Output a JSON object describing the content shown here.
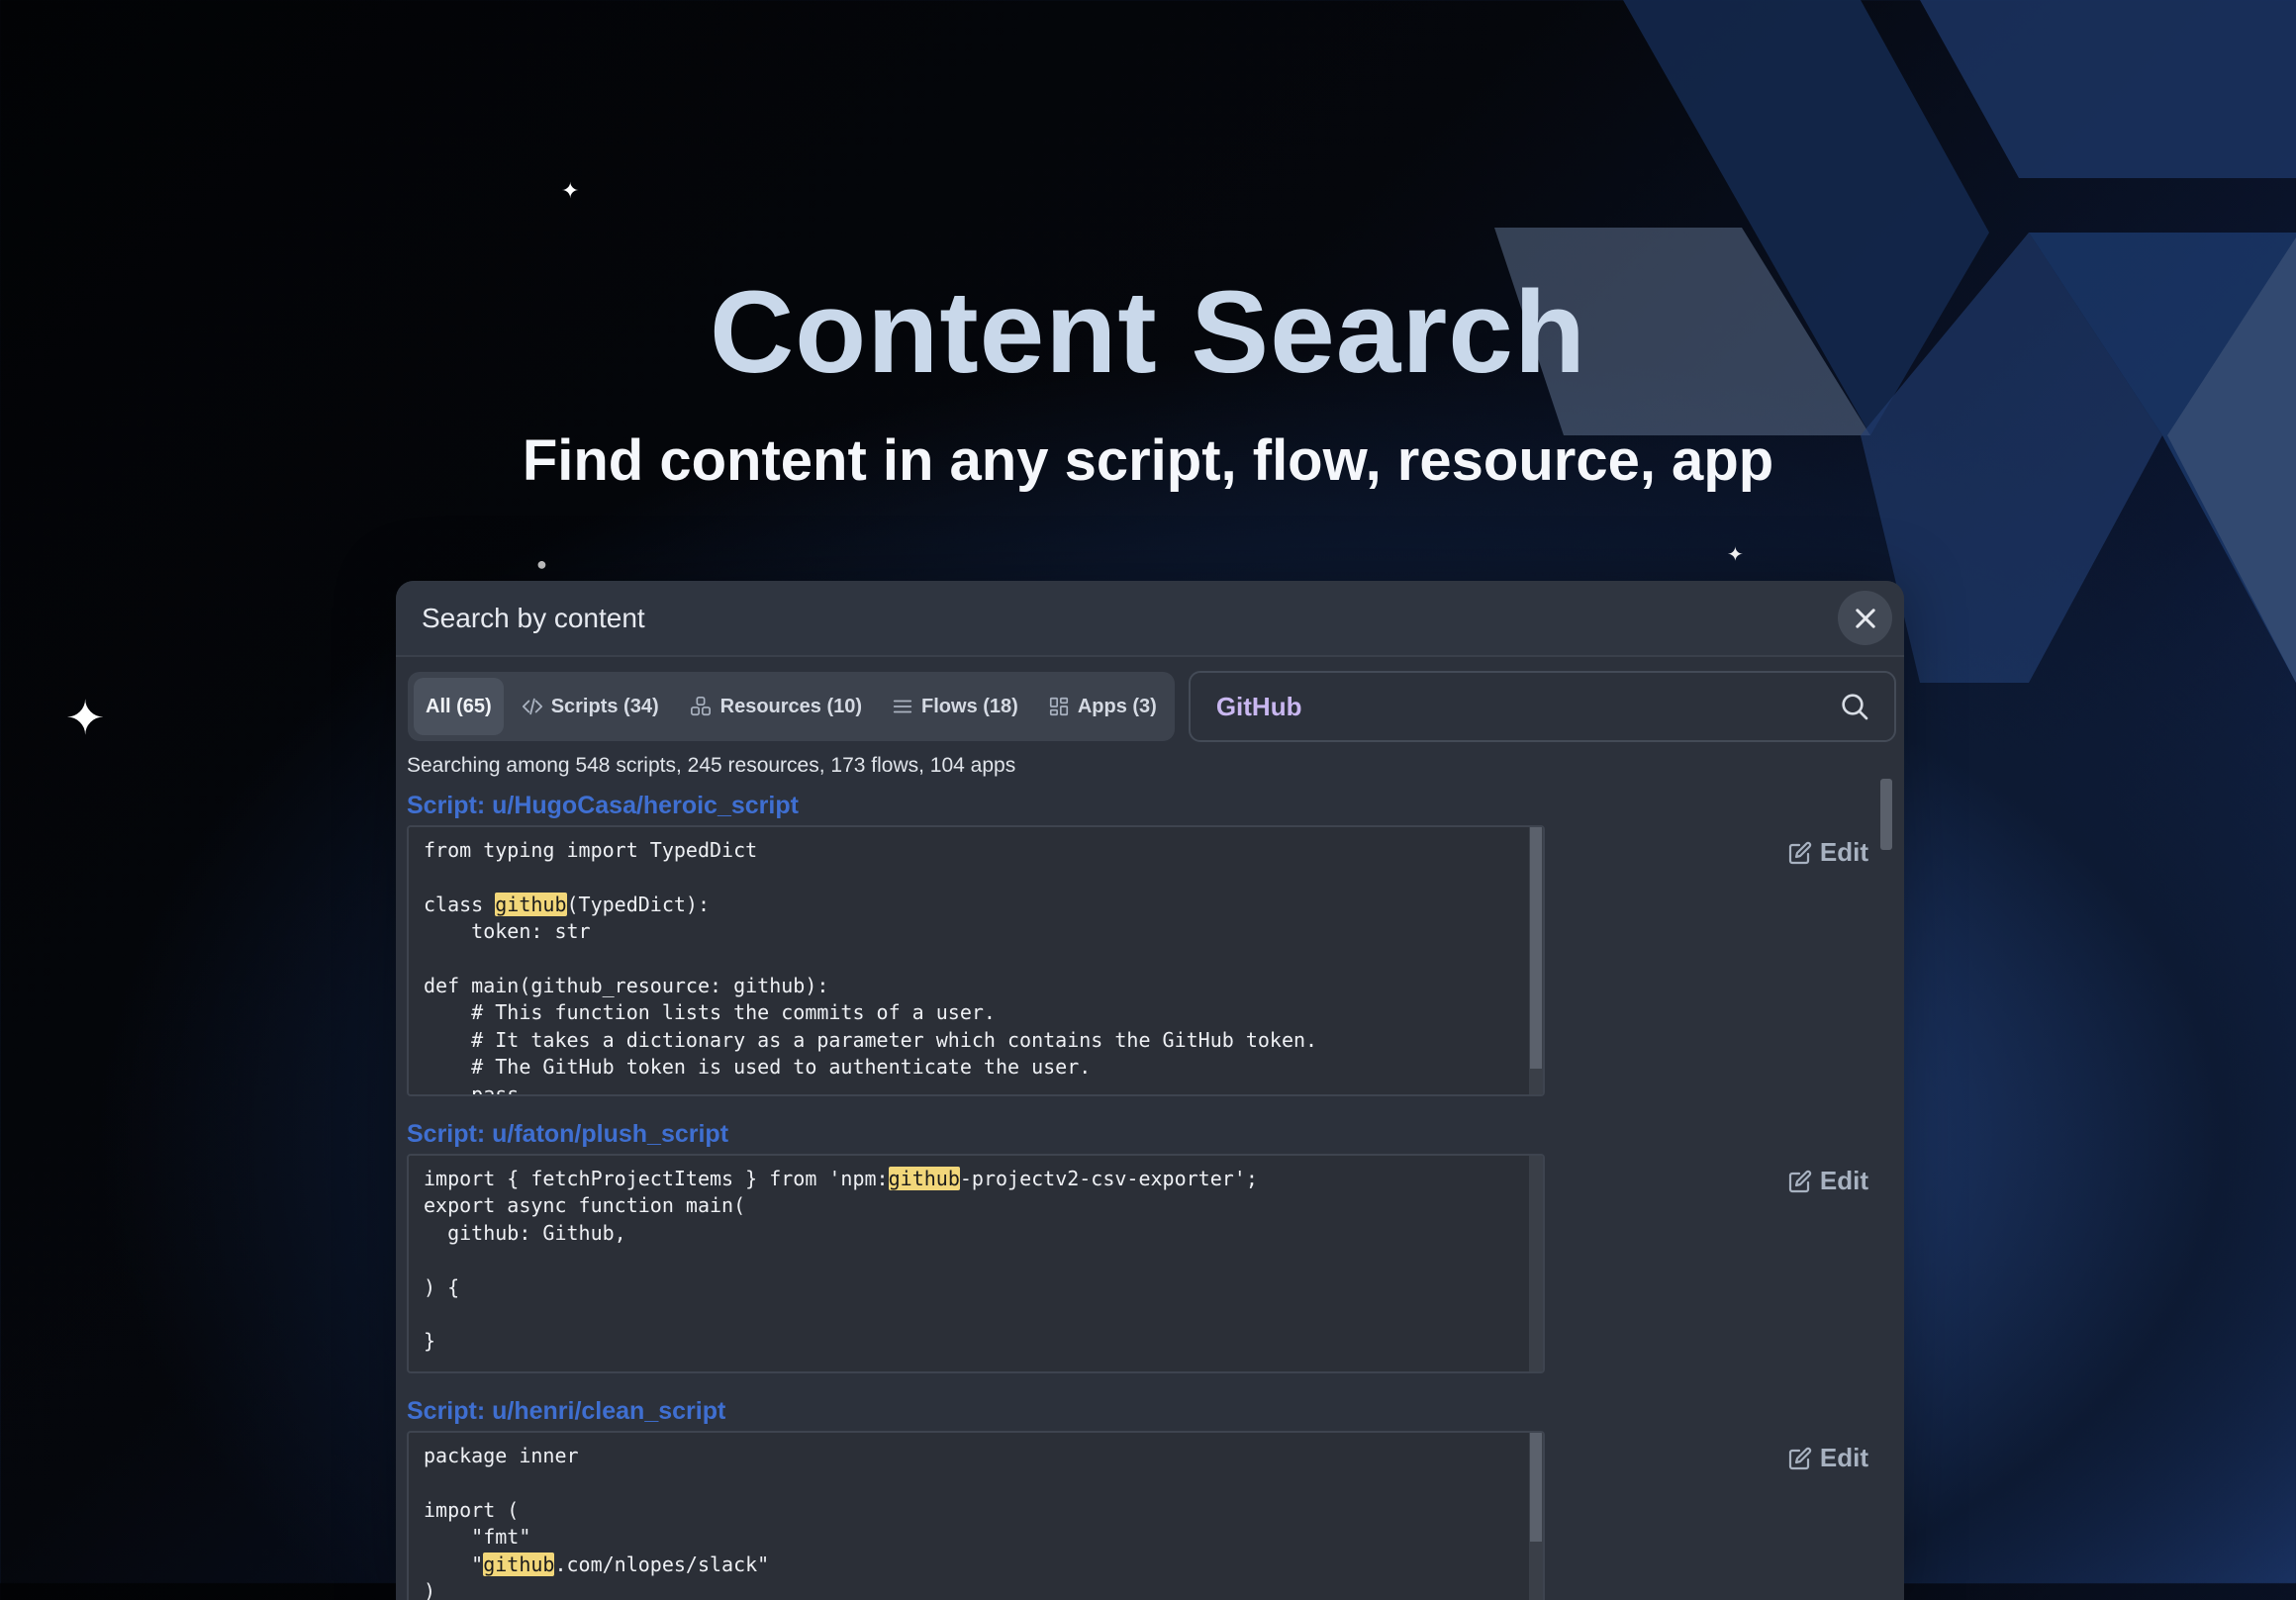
{
  "hero": {
    "title": "Content Search",
    "subtitle": "Find content in any script, flow, resource, app"
  },
  "modal": {
    "title": "Search by content",
    "close_icon": "close-icon",
    "tabs": [
      {
        "label": "All (65)",
        "icon": "",
        "active": true
      },
      {
        "label": "Scripts (34)",
        "icon": "code-icon"
      },
      {
        "label": "Resources (10)",
        "icon": "boxes-icon"
      },
      {
        "label": "Flows (18)",
        "icon": "bars-icon"
      },
      {
        "label": "Apps (3)",
        "icon": "grid-icon"
      }
    ],
    "search": {
      "value": "GitHub",
      "icon": "search-icon"
    },
    "info": "Searching among 548 scripts, 245 resources, 173 flows, 104 apps",
    "edit_label": "Edit",
    "results": [
      {
        "title": "Script: u/HugoCasa/heroic_script",
        "code": [
          [
            [
              "from typing import TypedDict",
              false
            ]
          ],
          [
            [
              "",
              false
            ]
          ],
          [
            [
              "class ",
              false
            ],
            [
              "github",
              true
            ],
            [
              "(TypedDict):",
              false
            ]
          ],
          [
            [
              "    token: str",
              false
            ]
          ],
          [
            [
              "",
              false
            ]
          ],
          [
            [
              "def main(github_resource: github):",
              false
            ]
          ],
          [
            [
              "    # This function lists the commits of a user.",
              false
            ]
          ],
          [
            [
              "    # It takes a dictionary as a parameter which contains the GitHub token.",
              false
            ]
          ],
          [
            [
              "    # The GitHub token is used to authenticate the user.",
              false
            ]
          ],
          [
            [
              "    pass",
              false
            ]
          ]
        ]
      },
      {
        "title": "Script: u/faton/plush_script",
        "code": [
          [
            [
              "import { fetchProjectItems } from 'npm:",
              false
            ],
            [
              "github",
              true
            ],
            [
              "-projectv2-csv-exporter';",
              false
            ]
          ],
          [
            [
              "export async function main(",
              false
            ]
          ],
          [
            [
              "  github: Github,",
              false
            ]
          ],
          [
            [
              "",
              false
            ]
          ],
          [
            [
              ") {",
              false
            ]
          ],
          [
            [
              "",
              false
            ]
          ],
          [
            [
              "}",
              false
            ]
          ]
        ]
      },
      {
        "title": "Script: u/henri/clean_script",
        "code": [
          [
            [
              "package inner",
              false
            ]
          ],
          [
            [
              "",
              false
            ]
          ],
          [
            [
              "import (",
              false
            ]
          ],
          [
            [
              "    \"fmt\"",
              false
            ]
          ],
          [
            [
              "    \"",
              false
            ],
            [
              "github",
              true
            ],
            [
              ".com/nlopes/slack\"",
              false
            ]
          ],
          [
            [
              ")",
              false
            ]
          ]
        ]
      }
    ]
  },
  "colors": {
    "accent_link": "#3f6fd1",
    "highlight": "#f2d77a",
    "modal_bg": "#2c313b"
  }
}
